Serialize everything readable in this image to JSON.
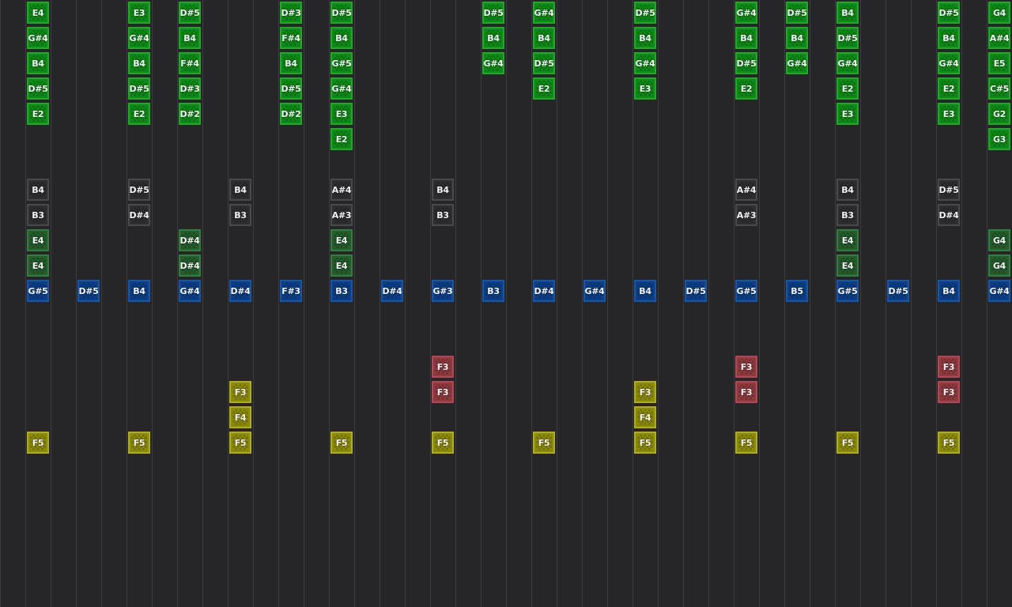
{
  "colors": {
    "green": "#0e8a18",
    "dark_green": "#245c2c",
    "grey": "#2e2e31",
    "blue": "#0b3f86",
    "red": "#8e3a3e",
    "yellow": "#8c8a0c"
  },
  "columns": [
    {
      "notes": [
        {
          "row": 0,
          "type": "green",
          "label": "E4"
        },
        {
          "row": 1,
          "type": "green",
          "label": "G#4"
        },
        {
          "row": 2,
          "type": "green",
          "label": "B4"
        },
        {
          "row": 3,
          "type": "green",
          "label": "D#5"
        },
        {
          "row": 4,
          "type": "green",
          "label": "E2"
        },
        {
          "row": 7,
          "type": "grey",
          "label": "B4"
        },
        {
          "row": 8,
          "type": "grey",
          "label": "B3"
        },
        {
          "row": 9,
          "type": "dgreen",
          "label": "E4"
        },
        {
          "row": 10,
          "type": "dgreen",
          "label": "E4"
        },
        {
          "row": 11,
          "type": "blue",
          "label": "G#5"
        },
        {
          "row": 17,
          "type": "yellow",
          "label": "F5"
        }
      ]
    },
    {
      "notes": [
        {
          "row": 11,
          "type": "blue",
          "label": "D#5"
        }
      ]
    },
    {
      "notes": [
        {
          "row": 0,
          "type": "green",
          "label": "E3"
        },
        {
          "row": 1,
          "type": "green",
          "label": "G#4"
        },
        {
          "row": 2,
          "type": "green",
          "label": "B4"
        },
        {
          "row": 3,
          "type": "green",
          "label": "D#5"
        },
        {
          "row": 4,
          "type": "green",
          "label": "E2"
        },
        {
          "row": 7,
          "type": "grey",
          "label": "D#5"
        },
        {
          "row": 8,
          "type": "grey",
          "label": "D#4"
        },
        {
          "row": 11,
          "type": "blue",
          "label": "B4"
        },
        {
          "row": 17,
          "type": "yellow",
          "label": "F5"
        }
      ]
    },
    {
      "notes": [
        {
          "row": 0,
          "type": "green",
          "label": "D#5"
        },
        {
          "row": 1,
          "type": "green",
          "label": "B4"
        },
        {
          "row": 2,
          "type": "green",
          "label": "F#4"
        },
        {
          "row": 3,
          "type": "green",
          "label": "D#3"
        },
        {
          "row": 4,
          "type": "green",
          "label": "D#2"
        },
        {
          "row": 9,
          "type": "dgreen",
          "label": "D#4"
        },
        {
          "row": 10,
          "type": "dgreen",
          "label": "D#4"
        },
        {
          "row": 11,
          "type": "blue",
          "label": "G#4"
        }
      ]
    },
    {
      "notes": [
        {
          "row": 7,
          "type": "grey",
          "label": "B4"
        },
        {
          "row": 8,
          "type": "grey",
          "label": "B3"
        },
        {
          "row": 11,
          "type": "blue",
          "label": "D#4"
        },
        {
          "row": 15,
          "type": "yellow",
          "label": "F3"
        },
        {
          "row": 16,
          "type": "yellow",
          "label": "F4"
        },
        {
          "row": 17,
          "type": "yellow",
          "label": "F5"
        }
      ]
    },
    {
      "notes": [
        {
          "row": 0,
          "type": "green",
          "label": "D#3"
        },
        {
          "row": 1,
          "type": "green",
          "label": "F#4"
        },
        {
          "row": 2,
          "type": "green",
          "label": "B4"
        },
        {
          "row": 3,
          "type": "green",
          "label": "D#5"
        },
        {
          "row": 4,
          "type": "green",
          "label": "D#2"
        },
        {
          "row": 11,
          "type": "blue",
          "label": "F#3"
        }
      ]
    },
    {
      "notes": [
        {
          "row": 0,
          "type": "green",
          "label": "D#5"
        },
        {
          "row": 1,
          "type": "green",
          "label": "B4"
        },
        {
          "row": 2,
          "type": "green",
          "label": "G#5"
        },
        {
          "row": 3,
          "type": "green",
          "label": "G#4"
        },
        {
          "row": 4,
          "type": "green",
          "label": "E3"
        },
        {
          "row": 5,
          "type": "green",
          "label": "E2"
        },
        {
          "row": 7,
          "type": "grey",
          "label": "A#4"
        },
        {
          "row": 8,
          "type": "grey",
          "label": "A#3"
        },
        {
          "row": 9,
          "type": "dgreen",
          "label": "E4"
        },
        {
          "row": 10,
          "type": "dgreen",
          "label": "E4"
        },
        {
          "row": 11,
          "type": "blue",
          "label": "B3"
        },
        {
          "row": 17,
          "type": "yellow",
          "label": "F5"
        }
      ]
    },
    {
      "notes": [
        {
          "row": 11,
          "type": "blue",
          "label": "D#4"
        }
      ]
    },
    {
      "notes": [
        {
          "row": 7,
          "type": "grey",
          "label": "B4"
        },
        {
          "row": 8,
          "type": "grey",
          "label": "B3"
        },
        {
          "row": 11,
          "type": "blue",
          "label": "G#3"
        },
        {
          "row": 14,
          "type": "red",
          "label": "F3"
        },
        {
          "row": 15,
          "type": "red",
          "label": "F3"
        },
        {
          "row": 17,
          "type": "yellow",
          "label": "F5"
        }
      ]
    },
    {
      "notes": [
        {
          "row": 0,
          "type": "green",
          "label": "D#5"
        },
        {
          "row": 1,
          "type": "green",
          "label": "B4"
        },
        {
          "row": 2,
          "type": "green",
          "label": "G#4"
        },
        {
          "row": 11,
          "type": "blue",
          "label": "B3"
        }
      ]
    },
    {
      "notes": [
        {
          "row": 0,
          "type": "green",
          "label": "G#4"
        },
        {
          "row": 1,
          "type": "green",
          "label": "B4"
        },
        {
          "row": 2,
          "type": "green",
          "label": "D#5"
        },
        {
          "row": 3,
          "type": "green",
          "label": "E2"
        },
        {
          "row": 11,
          "type": "blue",
          "label": "D#4"
        },
        {
          "row": 17,
          "type": "yellow",
          "label": "F5"
        }
      ]
    },
    {
      "notes": [
        {
          "row": 11,
          "type": "blue",
          "label": "G#4"
        }
      ]
    },
    {
      "notes": [
        {
          "row": 0,
          "type": "green",
          "label": "D#5"
        },
        {
          "row": 1,
          "type": "green",
          "label": "B4"
        },
        {
          "row": 2,
          "type": "green",
          "label": "G#4"
        },
        {
          "row": 3,
          "type": "green",
          "label": "E3"
        },
        {
          "row": 11,
          "type": "blue",
          "label": "B4"
        },
        {
          "row": 15,
          "type": "yellow",
          "label": "F3"
        },
        {
          "row": 16,
          "type": "yellow",
          "label": "F4"
        },
        {
          "row": 17,
          "type": "yellow",
          "label": "F5"
        }
      ]
    },
    {
      "notes": [
        {
          "row": 11,
          "type": "blue",
          "label": "D#5"
        }
      ]
    },
    {
      "notes": [
        {
          "row": 0,
          "type": "green",
          "label": "G#4"
        },
        {
          "row": 1,
          "type": "green",
          "label": "B4"
        },
        {
          "row": 2,
          "type": "green",
          "label": "D#5"
        },
        {
          "row": 3,
          "type": "green",
          "label": "E2"
        },
        {
          "row": 7,
          "type": "grey",
          "label": "A#4"
        },
        {
          "row": 8,
          "type": "grey",
          "label": "A#3"
        },
        {
          "row": 11,
          "type": "blue",
          "label": "G#5"
        },
        {
          "row": 14,
          "type": "red",
          "label": "F3"
        },
        {
          "row": 15,
          "type": "red",
          "label": "F3"
        },
        {
          "row": 17,
          "type": "yellow",
          "label": "F5"
        }
      ]
    },
    {
      "notes": [
        {
          "row": 0,
          "type": "green",
          "label": "D#5"
        },
        {
          "row": 1,
          "type": "green",
          "label": "B4"
        },
        {
          "row": 2,
          "type": "green",
          "label": "G#4"
        },
        {
          "row": 11,
          "type": "blue",
          "label": "B5"
        }
      ]
    },
    {
      "notes": [
        {
          "row": 0,
          "type": "green",
          "label": "B4"
        },
        {
          "row": 1,
          "type": "green",
          "label": "D#5"
        },
        {
          "row": 2,
          "type": "green",
          "label": "G#4"
        },
        {
          "row": 3,
          "type": "green",
          "label": "E2"
        },
        {
          "row": 4,
          "type": "green",
          "label": "E3"
        },
        {
          "row": 7,
          "type": "grey",
          "label": "B4"
        },
        {
          "row": 8,
          "type": "grey",
          "label": "B3"
        },
        {
          "row": 9,
          "type": "dgreen",
          "label": "E4"
        },
        {
          "row": 10,
          "type": "dgreen",
          "label": "E4"
        },
        {
          "row": 11,
          "type": "blue",
          "label": "G#5"
        },
        {
          "row": 17,
          "type": "yellow",
          "label": "F5"
        }
      ]
    },
    {
      "notes": [
        {
          "row": 11,
          "type": "blue",
          "label": "D#5"
        }
      ]
    },
    {
      "notes": [
        {
          "row": 0,
          "type": "green",
          "label": "D#5"
        },
        {
          "row": 1,
          "type": "green",
          "label": "B4"
        },
        {
          "row": 2,
          "type": "green",
          "label": "G#4"
        },
        {
          "row": 3,
          "type": "green",
          "label": "E2"
        },
        {
          "row": 4,
          "type": "green",
          "label": "E3"
        },
        {
          "row": 7,
          "type": "grey",
          "label": "D#5"
        },
        {
          "row": 8,
          "type": "grey",
          "label": "D#4"
        },
        {
          "row": 11,
          "type": "blue",
          "label": "B4"
        },
        {
          "row": 14,
          "type": "red",
          "label": "F3"
        },
        {
          "row": 15,
          "type": "red",
          "label": "F3"
        },
        {
          "row": 17,
          "type": "yellow",
          "label": "F5"
        }
      ]
    },
    {
      "notes": [
        {
          "row": 0,
          "type": "green",
          "label": "G4"
        },
        {
          "row": 1,
          "type": "green",
          "label": "A#4"
        },
        {
          "row": 2,
          "type": "green",
          "label": "E5"
        },
        {
          "row": 3,
          "type": "green",
          "label": "C#5"
        },
        {
          "row": 4,
          "type": "green",
          "label": "G2"
        },
        {
          "row": 5,
          "type": "green",
          "label": "G3"
        },
        {
          "row": 9,
          "type": "dgreen",
          "label": "G4"
        },
        {
          "row": 10,
          "type": "dgreen",
          "label": "G4"
        },
        {
          "row": 11,
          "type": "blue",
          "label": "G#4"
        }
      ]
    }
  ]
}
